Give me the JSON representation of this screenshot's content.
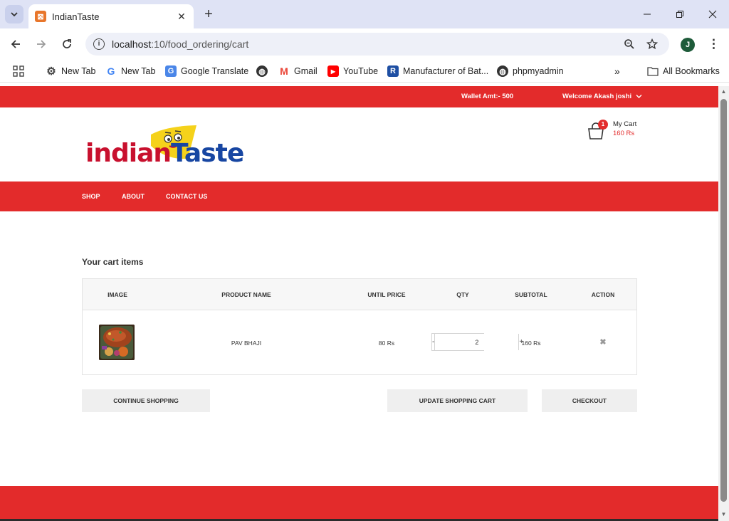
{
  "browser": {
    "tab_title": "IndianTaste",
    "url_host": "localhost",
    "url_path": ":10/food_ordering/cart",
    "profile_initial": "J",
    "bookmarks": [
      {
        "label": "New Tab",
        "icon": "gear-icon"
      },
      {
        "label": "New Tab",
        "icon": "google-icon"
      },
      {
        "label": "Google Translate",
        "icon": "translate-icon"
      },
      {
        "label": "",
        "icon": "globe-icon"
      },
      {
        "label": "Gmail",
        "icon": "gmail-icon"
      },
      {
        "label": "YouTube",
        "icon": "youtube-icon"
      },
      {
        "label": "Manufacturer of Bat...",
        "icon": "r-icon"
      },
      {
        "label": "phpmyadmin",
        "icon": "globe-icon"
      }
    ],
    "all_bookmarks": "All Bookmarks"
  },
  "site": {
    "wallet": "Wallet Amt:- 500",
    "welcome": "Welcome Akash joshi",
    "logo_part1": "indian",
    "logo_part2": "Taste",
    "cart_count": "1",
    "cart_label": "My Cart",
    "cart_total": "160 Rs",
    "nav": [
      "SHOP",
      "ABOUT",
      "CONTACT US"
    ],
    "colors": {
      "primary": "#e32b2b",
      "logo_red": "#c8102e",
      "logo_blue": "#1746a2"
    }
  },
  "cart": {
    "heading": "Your cart items",
    "columns": [
      "IMAGE",
      "PRODUCT NAME",
      "UNTIL PRICE",
      "QTY",
      "SUBTOTAL",
      "ACTION"
    ],
    "items": [
      {
        "name": "PAV BHAJI",
        "price": "80 Rs",
        "qty": "2",
        "subtotal": "160 Rs"
      }
    ],
    "buttons": {
      "continue": "CONTINUE SHOPPING",
      "update": "UPDATE SHOPPING CART",
      "checkout": "CHECKOUT"
    }
  }
}
